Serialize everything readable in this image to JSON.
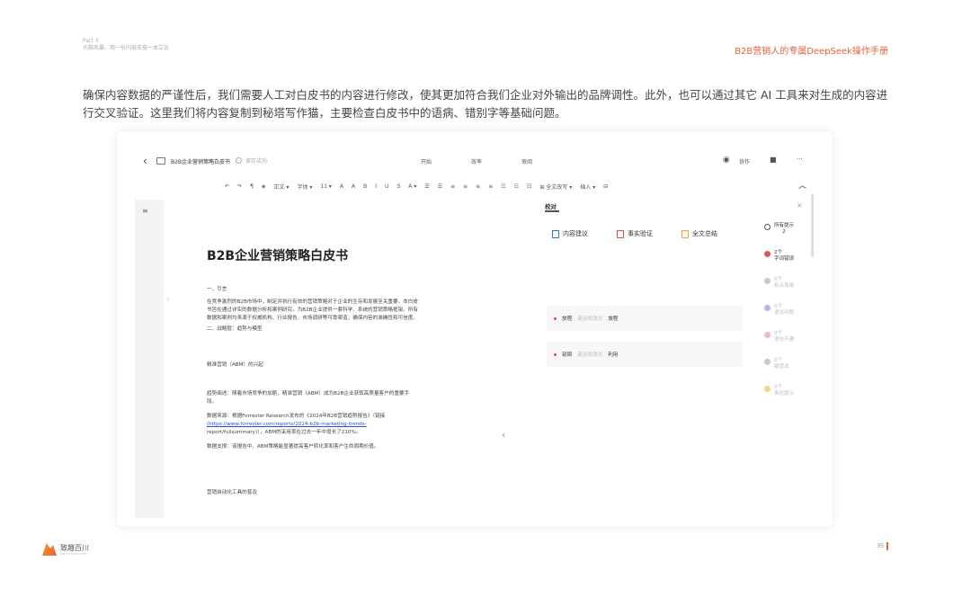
{
  "header": {
    "part": "Part 3",
    "part_subtitle": "头脑风暴、用一份内容支撑一本立论",
    "manual_title": "B2B营销人的专属DeepSeek操作手册"
  },
  "intro_text": "确保内容数据的严谨性后，我们需要人工对白皮书的内容进行修改，使其更加符合我们企业对外输出的品牌调性。此外，也可以通过其它 AI 工具来对生成的内容进行交叉验证。这里我们将内容复制到秘塔写作猫，主要检查白皮书中的语病、错别字等基础问题。",
  "editor": {
    "doc_name": "B2B企业营销策略白皮书",
    "saved_status": "保存成功",
    "menus": [
      "开始",
      "效率",
      "审阅"
    ],
    "top_right": [
      "协作",
      "···"
    ],
    "toolbar_items": [
      "↶",
      "↷",
      "¶",
      "◈",
      "正文 ▾",
      "字体 ▾",
      "11 ▾",
      "A",
      "A",
      "B",
      "I",
      "U",
      "S",
      "A ▾",
      "☰",
      "☰",
      "≡",
      "≡",
      "≡",
      "≡",
      "☷",
      "☷",
      "☷",
      "⊞ 全文改写 ▾",
      "插入 ▾",
      "⊟"
    ]
  },
  "document": {
    "title": "B2B企业营销策略白皮书",
    "lines": [
      "一、引言",
      "在竞争激烈的B2B市场中，制定并执行有效的营销策略对于企业的生存和发展至关重要。本白皮",
      "书旨在通过详实的数据分析和案例研究，为B2B企业提供一套科学、系统的营销策略框架。所有",
      "数据和案例均来源于权威机构、行业报告、市场调研等可靠渠道，确保内容的准确性和可信度。",
      "二、战略层：趋势与模型",
      "精准营销（ABM）的兴起",
      "趋势阐述：随着市场竞争的加剧，精准营销（ABM）成为B2B企业获取高质量客户的重要手",
      "段。",
      "数据来源：根据Forrester Research发布的《2024年B2B营销趋势报告》（链接",
      "(https://www.forrester.com/reports/2024-b2b-marketing-trends-",
      "report/fullsummary)），ABM的采用率在过去一年中增长了210%。",
      "数据支撑：该报告中，ABM策略能显著提高客户转化率和客户生命周期价值。",
      "营销自动化工具的普及"
    ]
  },
  "panel": {
    "tab": "校对",
    "close": "×",
    "buttons": [
      "内容建议",
      "事实验证",
      "全文总结"
    ],
    "issues": [
      {
        "original": "放程",
        "hint": "建议修改为",
        "fix": "旅程"
      },
      {
        "original": "韧周",
        "hint": "建议修改为",
        "fix": "利用"
      }
    ],
    "categories": [
      {
        "count": "所有提示",
        "label": "2"
      },
      {
        "count": "2个",
        "label": "字词错误"
      },
      {
        "count": "0个",
        "label": "标点误用"
      },
      {
        "count": "0个",
        "label": "语法问题"
      },
      {
        "count": "0个",
        "label": "语句不通"
      },
      {
        "count": "0个",
        "label": "敏感词"
      },
      {
        "count": "0个",
        "label": "表达提示"
      }
    ]
  },
  "footer": {
    "logo_text": "致趣百川",
    "logo_sub": "BEYONDSOFT",
    "page_number": "35"
  },
  "colors": {
    "accent": "#e8623a",
    "link": "#2a4fd6",
    "error": "#e64646"
  }
}
